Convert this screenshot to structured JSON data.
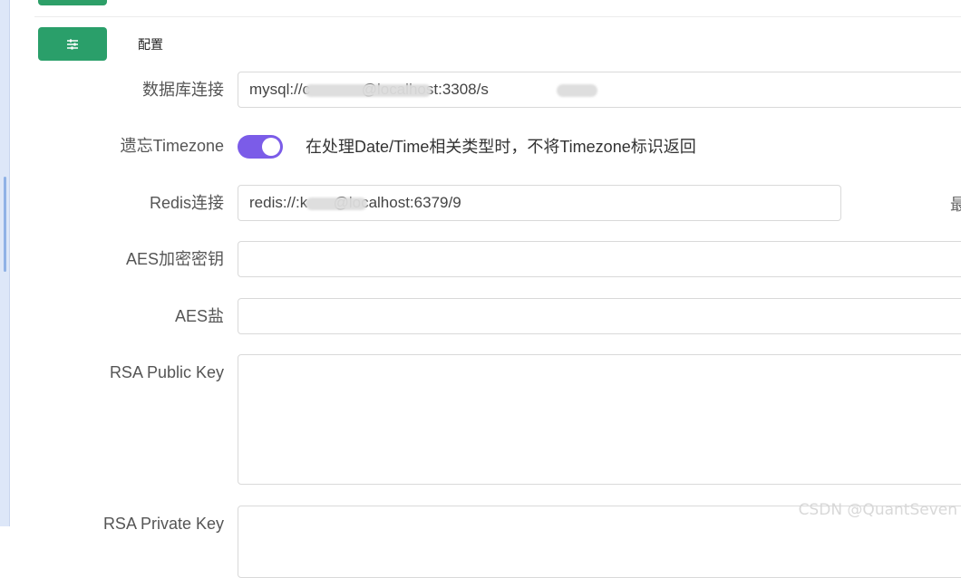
{
  "header": {
    "title": "配置"
  },
  "form": {
    "database": {
      "label": "数据库连接",
      "value": "mysql://c            @localhost:3308/s"
    },
    "timezone": {
      "label": "遗忘Timezone",
      "description": "在处理Date/Time相关类型时，不将Timezone标识返回"
    },
    "redis": {
      "label": "Redis连接",
      "value": "redis://:k      @localhost:6379/9"
    },
    "aes_key": {
      "label": "AES加密密钥",
      "value": ""
    },
    "aes_salt": {
      "label": "AES盐",
      "value": ""
    },
    "rsa_public": {
      "label": "RSA Public Key",
      "value": ""
    },
    "rsa_private": {
      "label": "RSA Private Key",
      "value": ""
    },
    "right_edge_text": "最"
  },
  "footer": {
    "watermark": "CSDN @QuantSeven"
  },
  "colors": {
    "primary_green": "#2a9f6a",
    "toggle_purple": "#7b5ce8"
  },
  "icons": {
    "config_button": "sliders-icon"
  }
}
